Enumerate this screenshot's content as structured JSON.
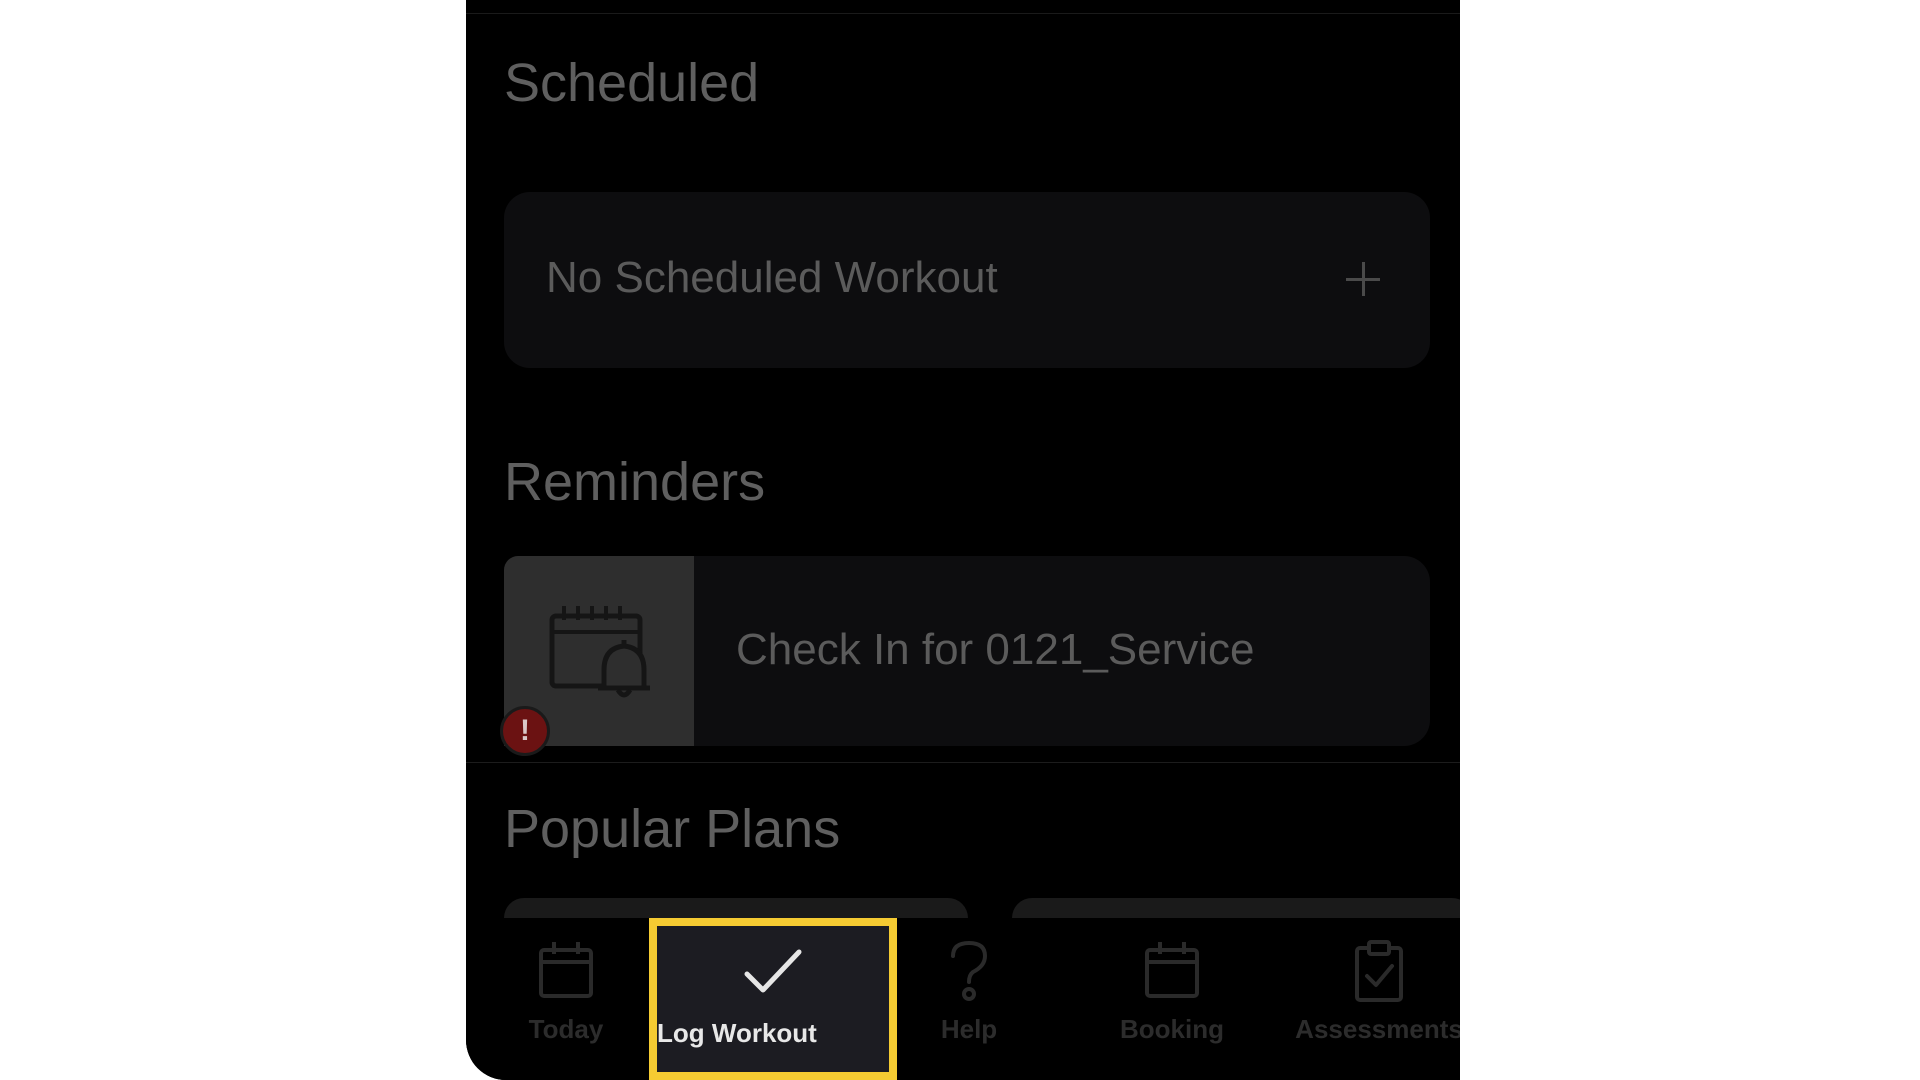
{
  "sections": {
    "scheduled_title": "Scheduled",
    "reminders_title": "Reminders",
    "popular_title": "Popular Plans"
  },
  "scheduled": {
    "empty_text": "No Scheduled Workout",
    "add_icon": "plus-icon"
  },
  "reminders": {
    "items": [
      {
        "icon": "calendar-bell-icon",
        "text": "Check In for 0121_Service",
        "badge": "!"
      }
    ]
  },
  "tabbar": {
    "items": [
      {
        "label": "Today",
        "icon": "calendar-icon"
      },
      {
        "label": "Log Workout",
        "icon": "checkmark-icon",
        "highlighted": true
      },
      {
        "label": "Help",
        "icon": "question-icon"
      },
      {
        "label": "Booking",
        "icon": "calendar-icon"
      },
      {
        "label": "Assessments",
        "icon": "clipboard-check-icon"
      }
    ]
  },
  "colors": {
    "highlight": "#f5cb32",
    "alert": "#6b1212",
    "background": "#000000"
  }
}
